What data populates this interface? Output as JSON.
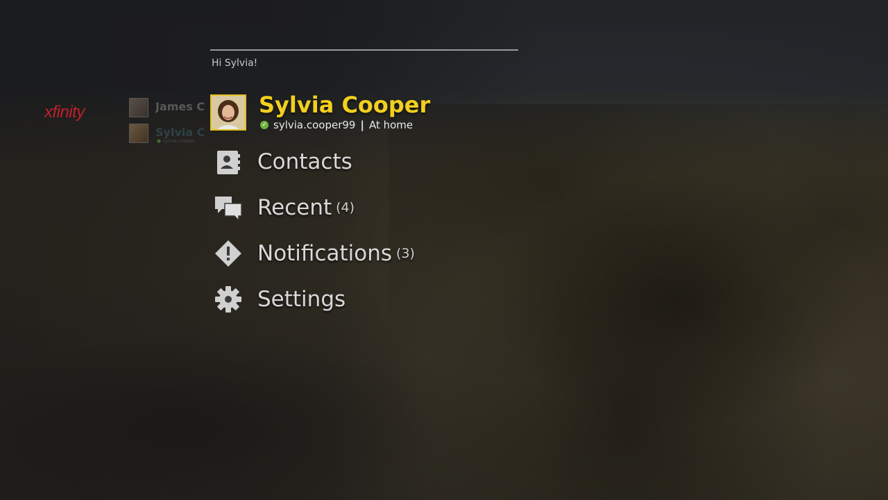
{
  "brand": {
    "logo_text": "xfinity",
    "logo_color": "#c0202a"
  },
  "accounts": [
    {
      "name": "James C",
      "sub": ""
    },
    {
      "name": "Sylvia C",
      "sub": "sylvia.cooper"
    }
  ],
  "greeting": "Hi Sylvia!",
  "profile": {
    "name": "Sylvia Cooper",
    "username": "sylvia.cooper99",
    "separator": "|",
    "location": "At home",
    "status_icon": "check-circle-icon",
    "name_color": "#f2cf1d"
  },
  "menu": {
    "items": [
      {
        "label": "Contacts",
        "count": "",
        "icon": "contact-card-icon"
      },
      {
        "label": "Recent",
        "count": "(4)",
        "icon": "chat-bubbles-icon"
      },
      {
        "label": "Notifications",
        "count": "(3)",
        "icon": "alert-diamond-icon"
      },
      {
        "label": "Settings",
        "count": "",
        "icon": "gear-icon"
      }
    ]
  }
}
